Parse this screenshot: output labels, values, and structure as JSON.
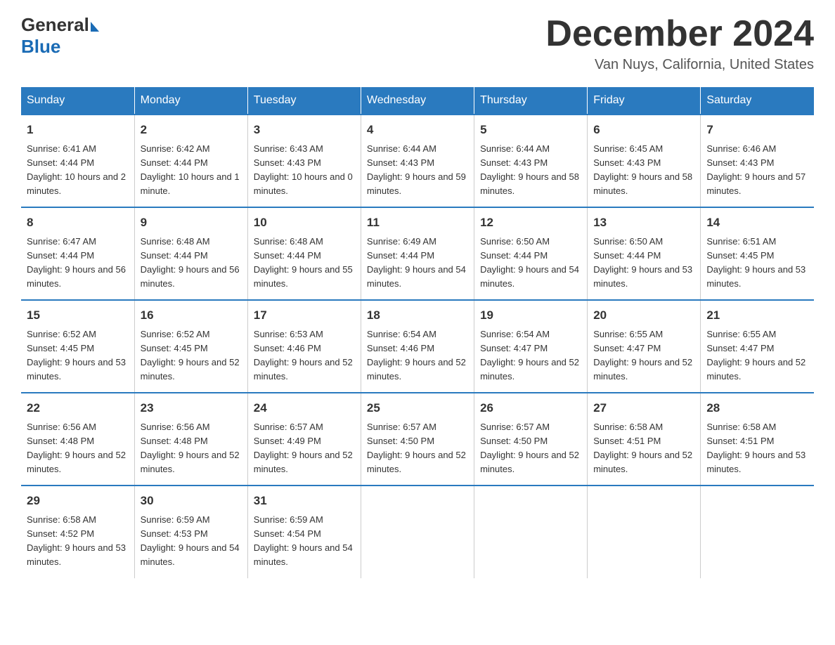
{
  "header": {
    "logo": {
      "general": "General",
      "blue": "Blue"
    },
    "title": "December 2024",
    "location": "Van Nuys, California, United States"
  },
  "weekdays": [
    "Sunday",
    "Monday",
    "Tuesday",
    "Wednesday",
    "Thursday",
    "Friday",
    "Saturday"
  ],
  "weeks": [
    [
      {
        "day": "1",
        "sunrise": "6:41 AM",
        "sunset": "4:44 PM",
        "daylight": "10 hours and 2 minutes."
      },
      {
        "day": "2",
        "sunrise": "6:42 AM",
        "sunset": "4:44 PM",
        "daylight": "10 hours and 1 minute."
      },
      {
        "day": "3",
        "sunrise": "6:43 AM",
        "sunset": "4:43 PM",
        "daylight": "10 hours and 0 minutes."
      },
      {
        "day": "4",
        "sunrise": "6:44 AM",
        "sunset": "4:43 PM",
        "daylight": "9 hours and 59 minutes."
      },
      {
        "day": "5",
        "sunrise": "6:44 AM",
        "sunset": "4:43 PM",
        "daylight": "9 hours and 58 minutes."
      },
      {
        "day": "6",
        "sunrise": "6:45 AM",
        "sunset": "4:43 PM",
        "daylight": "9 hours and 58 minutes."
      },
      {
        "day": "7",
        "sunrise": "6:46 AM",
        "sunset": "4:43 PM",
        "daylight": "9 hours and 57 minutes."
      }
    ],
    [
      {
        "day": "8",
        "sunrise": "6:47 AM",
        "sunset": "4:44 PM",
        "daylight": "9 hours and 56 minutes."
      },
      {
        "day": "9",
        "sunrise": "6:48 AM",
        "sunset": "4:44 PM",
        "daylight": "9 hours and 56 minutes."
      },
      {
        "day": "10",
        "sunrise": "6:48 AM",
        "sunset": "4:44 PM",
        "daylight": "9 hours and 55 minutes."
      },
      {
        "day": "11",
        "sunrise": "6:49 AM",
        "sunset": "4:44 PM",
        "daylight": "9 hours and 54 minutes."
      },
      {
        "day": "12",
        "sunrise": "6:50 AM",
        "sunset": "4:44 PM",
        "daylight": "9 hours and 54 minutes."
      },
      {
        "day": "13",
        "sunrise": "6:50 AM",
        "sunset": "4:44 PM",
        "daylight": "9 hours and 53 minutes."
      },
      {
        "day": "14",
        "sunrise": "6:51 AM",
        "sunset": "4:45 PM",
        "daylight": "9 hours and 53 minutes."
      }
    ],
    [
      {
        "day": "15",
        "sunrise": "6:52 AM",
        "sunset": "4:45 PM",
        "daylight": "9 hours and 53 minutes."
      },
      {
        "day": "16",
        "sunrise": "6:52 AM",
        "sunset": "4:45 PM",
        "daylight": "9 hours and 52 minutes."
      },
      {
        "day": "17",
        "sunrise": "6:53 AM",
        "sunset": "4:46 PM",
        "daylight": "9 hours and 52 minutes."
      },
      {
        "day": "18",
        "sunrise": "6:54 AM",
        "sunset": "4:46 PM",
        "daylight": "9 hours and 52 minutes."
      },
      {
        "day": "19",
        "sunrise": "6:54 AM",
        "sunset": "4:47 PM",
        "daylight": "9 hours and 52 minutes."
      },
      {
        "day": "20",
        "sunrise": "6:55 AM",
        "sunset": "4:47 PM",
        "daylight": "9 hours and 52 minutes."
      },
      {
        "day": "21",
        "sunrise": "6:55 AM",
        "sunset": "4:47 PM",
        "daylight": "9 hours and 52 minutes."
      }
    ],
    [
      {
        "day": "22",
        "sunrise": "6:56 AM",
        "sunset": "4:48 PM",
        "daylight": "9 hours and 52 minutes."
      },
      {
        "day": "23",
        "sunrise": "6:56 AM",
        "sunset": "4:48 PM",
        "daylight": "9 hours and 52 minutes."
      },
      {
        "day": "24",
        "sunrise": "6:57 AM",
        "sunset": "4:49 PM",
        "daylight": "9 hours and 52 minutes."
      },
      {
        "day": "25",
        "sunrise": "6:57 AM",
        "sunset": "4:50 PM",
        "daylight": "9 hours and 52 minutes."
      },
      {
        "day": "26",
        "sunrise": "6:57 AM",
        "sunset": "4:50 PM",
        "daylight": "9 hours and 52 minutes."
      },
      {
        "day": "27",
        "sunrise": "6:58 AM",
        "sunset": "4:51 PM",
        "daylight": "9 hours and 52 minutes."
      },
      {
        "day": "28",
        "sunrise": "6:58 AM",
        "sunset": "4:51 PM",
        "daylight": "9 hours and 53 minutes."
      }
    ],
    [
      {
        "day": "29",
        "sunrise": "6:58 AM",
        "sunset": "4:52 PM",
        "daylight": "9 hours and 53 minutes."
      },
      {
        "day": "30",
        "sunrise": "6:59 AM",
        "sunset": "4:53 PM",
        "daylight": "9 hours and 54 minutes."
      },
      {
        "day": "31",
        "sunrise": "6:59 AM",
        "sunset": "4:54 PM",
        "daylight": "9 hours and 54 minutes."
      },
      null,
      null,
      null,
      null
    ]
  ]
}
